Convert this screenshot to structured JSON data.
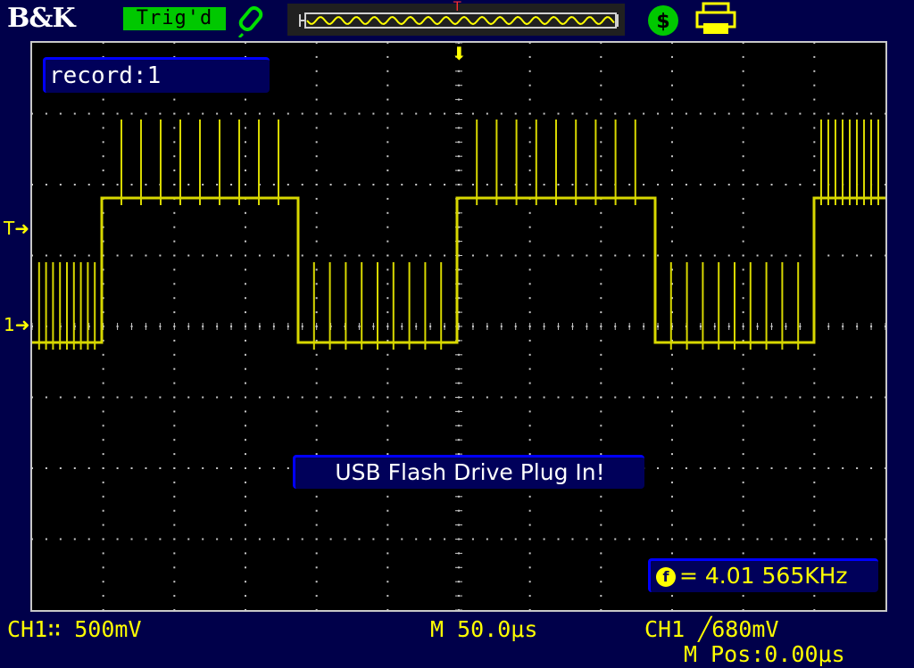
{
  "header": {
    "brand": "B&K",
    "trigger_status": "Trig'd",
    "probe_icon": "probe-icon",
    "usb_icon": "usb-icon",
    "printer_icon": "printer-icon",
    "trigger_position_marker": "T"
  },
  "screen": {
    "record_label": "record:1",
    "message": "USB Flash Drive Plug In!",
    "frequency_label": "= 4.01 565KHz",
    "trigger_level_marker": "T",
    "channel_marker": "1"
  },
  "footer": {
    "ch1_scale": "CH1∷ 500mV",
    "timebase": "M 50.0μs",
    "trigger_setting": "CH1 ╱680mV",
    "m_position": "M Pos:0.00μs"
  },
  "colors": {
    "trace": "#d8d800",
    "background": "#00004a",
    "graticule": "#c8c8c8",
    "status_green": "#00c800"
  }
}
